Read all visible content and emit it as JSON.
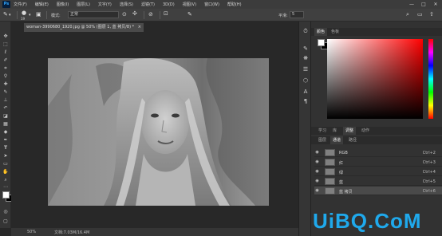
{
  "app": {
    "logo": "Ps"
  },
  "menu": [
    "文件(F)",
    "编辑(E)",
    "图像(I)",
    "图层(L)",
    "文字(Y)",
    "选择(S)",
    "滤镜(T)",
    "3D(D)",
    "视图(V)",
    "窗口(W)",
    "帮助(H)"
  ],
  "window_controls": {
    "minimize": "—",
    "maximize": "□",
    "close": "✕"
  },
  "options": {
    "brush_size": "19",
    "mode_label": "模式:",
    "mode_value": "正常",
    "smoothing_label": "平滑:",
    "smoothing_value": "5"
  },
  "tools": [
    "move-icon",
    "marquee-icon",
    "lasso-icon",
    "quick-select-icon",
    "crop-icon",
    "eyedropper-icon",
    "healing-icon",
    "brush-icon",
    "clone-stamp-icon",
    "history-brush-icon",
    "eraser-icon",
    "gradient-icon",
    "blur-icon",
    "dodge-icon",
    "pen-icon",
    "type-icon",
    "path-select-icon",
    "shape-icon",
    "hand-icon",
    "zoom-icon"
  ],
  "document": {
    "tab_title": "woman-3990680_1920.jpg @ 50% (图层 1, 蓝 拷贝/8) *",
    "close": "×"
  },
  "status": {
    "zoom": "50%",
    "doc_info": "文档:7.03M/16.4M"
  },
  "color_panel": {
    "tabs": [
      "颜色",
      "色板"
    ],
    "foreground": "#ffffff",
    "background": "#000000"
  },
  "layers_panel": {
    "tabs_top": [
      "学习",
      "库",
      "调整",
      "动作"
    ],
    "tabs_sub": [
      "图层",
      "通道",
      "路径"
    ],
    "channels": [
      {
        "name": "RGB",
        "shortcut": "Ctrl+2",
        "visible": true,
        "selected": false
      },
      {
        "name": "红",
        "shortcut": "Ctrl+3",
        "visible": true,
        "selected": false
      },
      {
        "name": "绿",
        "shortcut": "Ctrl+4",
        "visible": true,
        "selected": false
      },
      {
        "name": "蓝",
        "shortcut": "Ctrl+5",
        "visible": true,
        "selected": false
      },
      {
        "name": "蓝 拷贝",
        "shortcut": "Ctrl+6",
        "visible": true,
        "selected": true
      }
    ],
    "eye_glyph": "◉"
  },
  "watermark": "UiBQ.CoM",
  "colors": {
    "accent": "#31a8ff",
    "watermark": "#1fa9ec"
  }
}
